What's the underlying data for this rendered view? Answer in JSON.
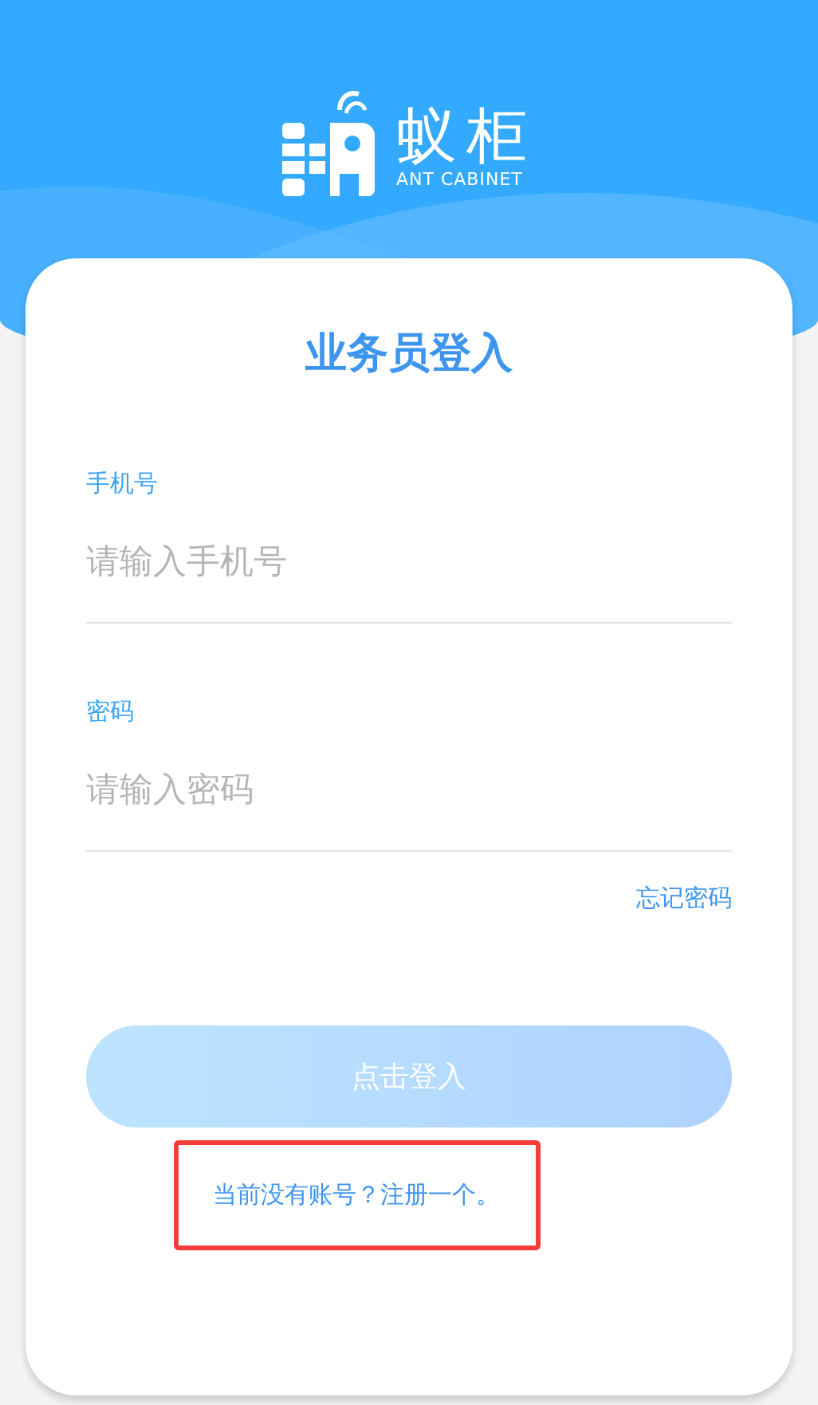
{
  "logo": {
    "name": "蚁柜",
    "subtitle": "ANT CABINET"
  },
  "title": "业务员登入",
  "fields": [
    {
      "label": "手机号",
      "placeholder": "请输入手机号"
    },
    {
      "label": "密码",
      "placeholder": "请输入密码"
    }
  ],
  "forgot_link": "忘记密码",
  "login_button": {
    "label": "点击登入",
    "disabled": true
  },
  "register_link": {
    "text": "当前没有账号？注册一个。",
    "highlighted": true
  }
}
